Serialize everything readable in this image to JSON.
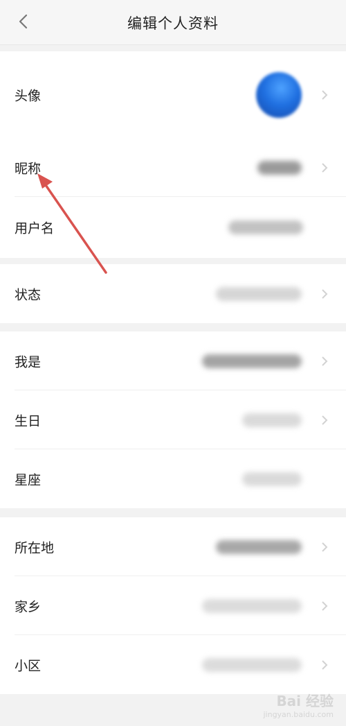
{
  "header": {
    "title": "编辑个人资料",
    "back_icon": "chevron-left-icon"
  },
  "rows": {
    "avatar_label": "头像",
    "nickname_label": "昵称",
    "username_label": "用户名",
    "status_label": "状态",
    "i_am_label": "我是",
    "birthday_label": "生日",
    "zodiac_label": "星座",
    "location_label": "所在地",
    "hometown_label": "家乡",
    "community_label": "小区"
  },
  "annotation": {
    "color": "#d9534f",
    "icon": "red-arrow-annotation"
  },
  "watermark": {
    "brand": "Bai 经验",
    "url": "jingyan.baidu.com"
  },
  "colors": {
    "background": "#f2f2f2",
    "card": "#ffffff",
    "arrow": "#d9534f"
  }
}
